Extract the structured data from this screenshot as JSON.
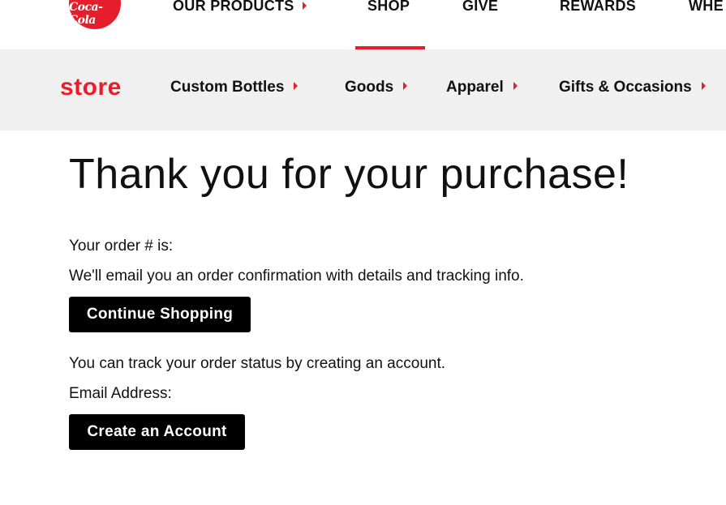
{
  "brand": {
    "logo_text": "Coca-Cola",
    "accent_color": "#e61e2b"
  },
  "topnav": {
    "items": [
      {
        "label": "OUR PRODUCTS",
        "has_caret": true
      },
      {
        "label": "SHOP",
        "active": true
      },
      {
        "label": "GIVE"
      },
      {
        "label": "REWARDS"
      },
      {
        "label": "WHE"
      }
    ]
  },
  "subnav": {
    "title": "store",
    "items": [
      {
        "label": "Custom Bottles"
      },
      {
        "label": "Goods"
      },
      {
        "label": "Apparel"
      },
      {
        "label": "Gifts & Occasions"
      }
    ]
  },
  "main": {
    "headline": "Thank you for your purchase!",
    "order_label": "Your order # is:",
    "email_note": "We'll email you an order confirmation with details and tracking info.",
    "continue_button": "Continue Shopping",
    "track_note": "You can track your order status by creating an account.",
    "email_label": "Email Address:",
    "create_button": "Create an Account"
  }
}
